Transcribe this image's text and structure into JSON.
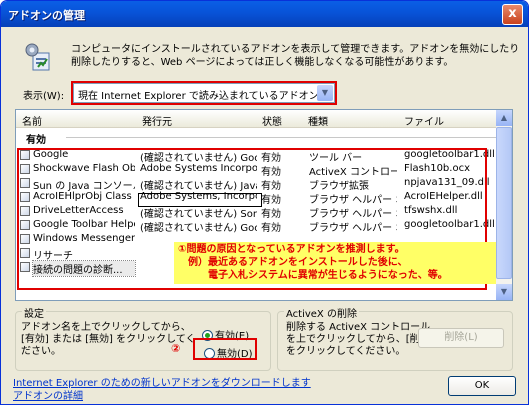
{
  "window": {
    "title": "アドオンの管理",
    "close_label": "x"
  },
  "description": "コンピュータにインストールされているアドオンを表示して管理できます。アドオンを無効にしたり削除したりすると、Web ページによっては正しく機能しなくなる可能性があります。",
  "show": {
    "label": "表示(W):",
    "value": "現在 Internet Explorer で読み込まれているアドオン"
  },
  "list": {
    "columns": [
      "名前",
      "発行元",
      "状態",
      "種類",
      "ファイル"
    ],
    "group": "有効",
    "rows": [
      [
        "Google",
        "(確認されていません) Googl...",
        "有効",
        "ツール バー",
        "googletoolbar1.dll"
      ],
      [
        "Shockwave Flash Object",
        "Adobe Systems Incorpora...",
        "有効",
        "ActiveX コントロール",
        "Flash10b.ocx"
      ],
      [
        "Sun の Java コンソール",
        "(確認されていません) Java...",
        "有効",
        "ブラウザ拡張",
        "npjava131_09.dll"
      ],
      [
        "AcroIEHlprObj Class",
        "Adobe Systems, Incorporated",
        "有効",
        "ブラウザ ヘルパー オブ...",
        "AcroIEHelper.dll"
      ],
      [
        "DriveLetterAccess",
        "(確認されていません) Sonic...",
        "有効",
        "ブラウザ ヘルパー オブ...",
        "tfswshx.dll"
      ],
      [
        "Google Toolbar Helper",
        "(確認されていません) Googl...",
        "有効",
        "ブラウザ ヘルパー オブ...",
        "googletoolbar1.dll"
      ],
      [
        "Windows Messenger",
        "",
        "",
        "",
        ""
      ],
      [
        "リサーチ",
        "",
        "",
        "",
        ""
      ],
      [
        "接続の問題の診断...",
        "",
        "",
        "",
        ""
      ]
    ],
    "note": [
      "①問題の原因となっているアドオンを推測します。",
      "例）最近あるアドオンをインストールした後に、",
      "電子入札システムに異常が生じるようになった、等。"
    ]
  },
  "settings": {
    "title": "設定",
    "desc": "アドオン名を上でクリックしてから、[有効] または [無効] をクリックしてください。",
    "enable": "有効(E)",
    "disable": "無効(D)",
    "marker": "②"
  },
  "activex": {
    "title": "ActiveX の削除",
    "desc": "削除する ActiveX コントロールを上でクリックしてから、[削除] をクリックしてください。",
    "delete": "削除(L)"
  },
  "links": {
    "download": "Internet Explorer のための新しいアドオンをダウンロードします",
    "details": "アドオンの詳細"
  },
  "ok": "OK",
  "icons": {
    "up": "▲",
    "down": "▼",
    "dropdown": "▼"
  },
  "colors": {
    "title_bar": "#0853d8",
    "highlight_red": "#e00000",
    "note_bg": "#ffff66"
  }
}
